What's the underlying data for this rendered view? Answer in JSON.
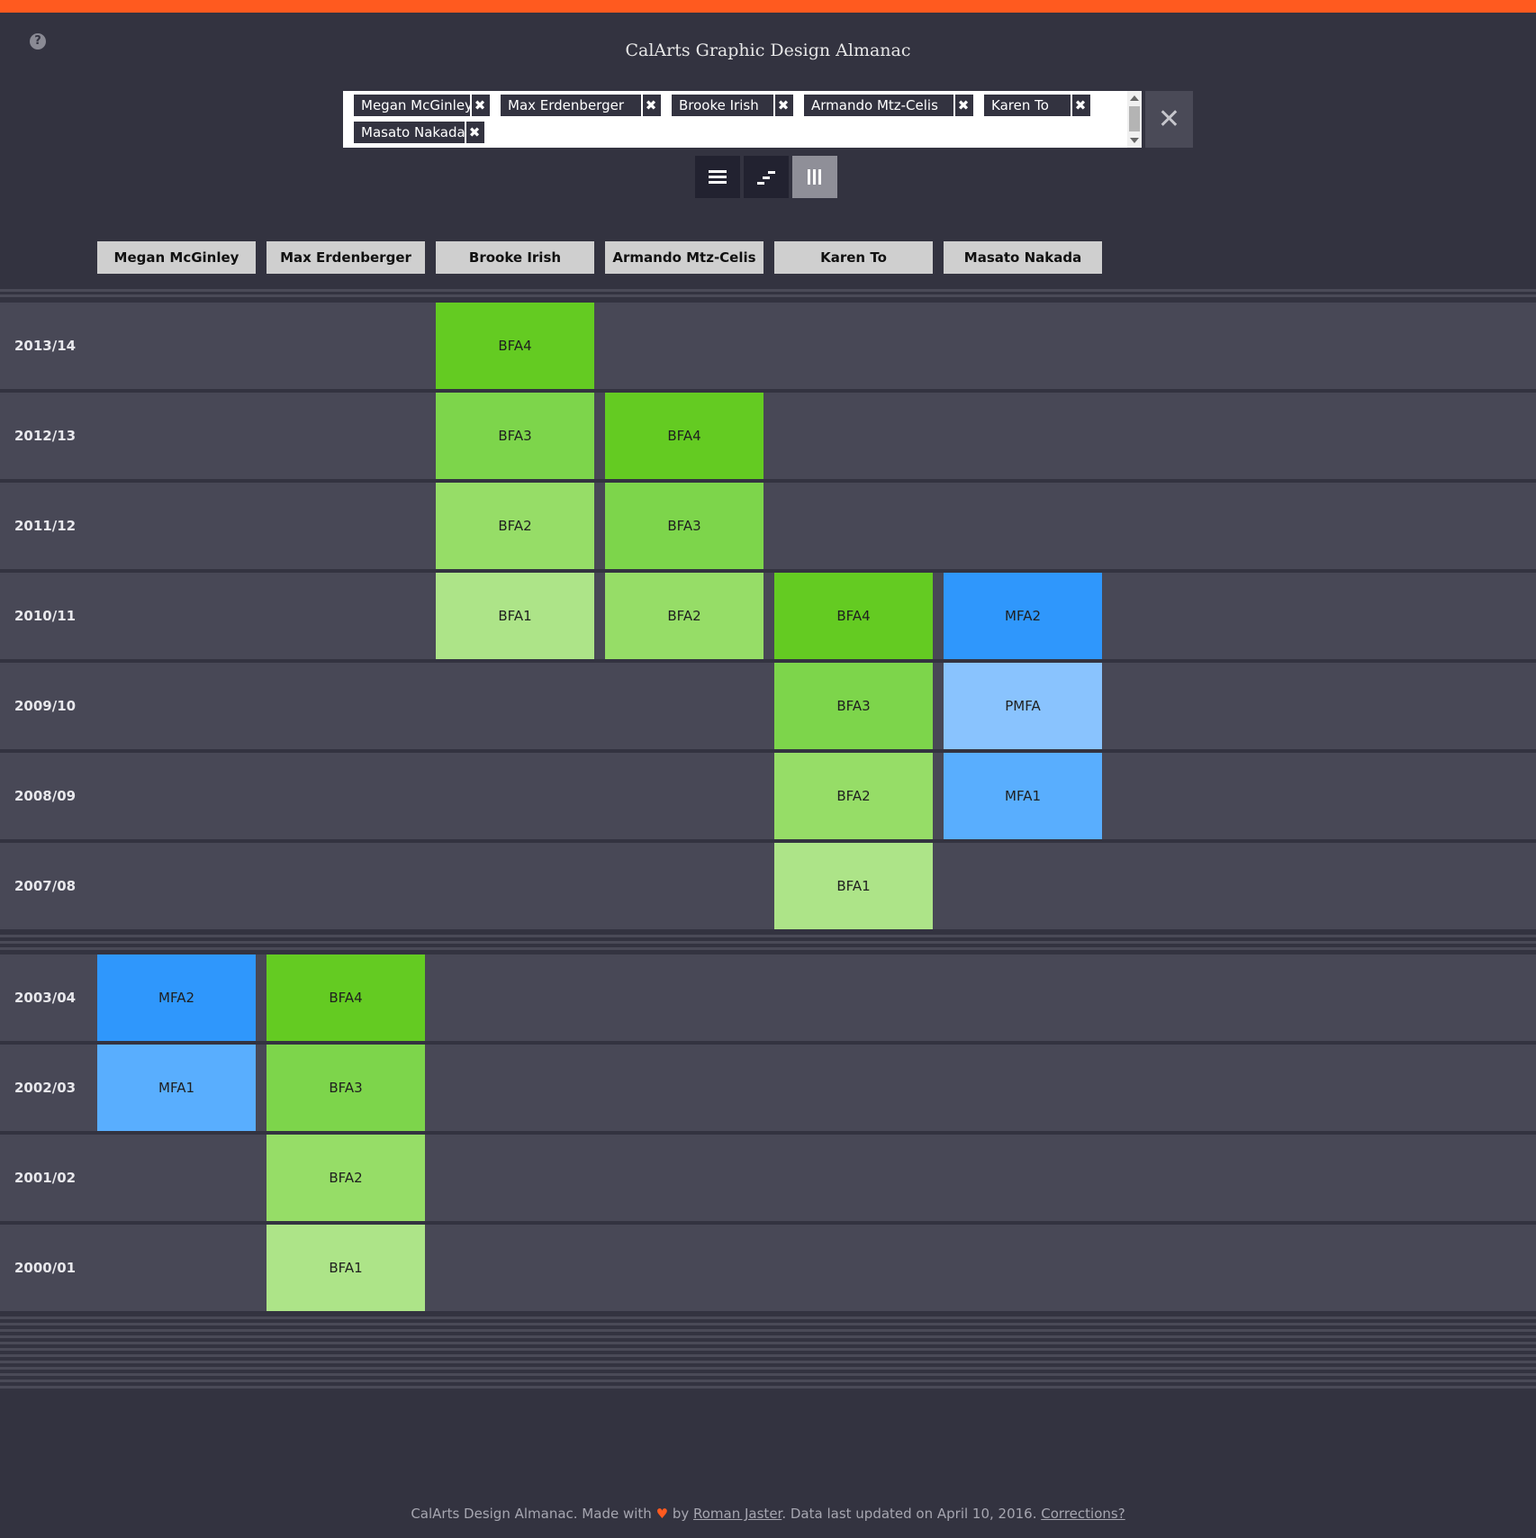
{
  "app": {
    "title": "CalArts Graphic Design Almanac",
    "help_icon": "?"
  },
  "filter": {
    "tags": [
      "Megan McGinley",
      "Max Erdenberger",
      "Brooke Irish",
      "Armando Mtz-Celis",
      "Karen To",
      "Masato Nakada"
    ],
    "remove_glyph": "✖",
    "clear_glyph": "✕"
  },
  "views": [
    "list-icon",
    "timeline-icon",
    "columns-icon"
  ],
  "active_view": "columns-icon",
  "columns": [
    "Megan McGinley",
    "Max Erdenberger",
    "Brooke Irish",
    "Armando Mtz-Celis",
    "Karen To",
    "Masato Nakada"
  ],
  "colors": {
    "BFA1": "#ade488",
    "BFA2": "#96dd67",
    "BFA3": "#7dd54b",
    "BFA4": "#64cb22",
    "MFA1": "#59aefe",
    "MFA2": "#2f97fc",
    "PMFA": "#89c3fe",
    "accent": "#ff5a1f"
  },
  "years": [
    {
      "label": "2013/14",
      "cells": [
        "",
        "",
        "BFA4",
        "",
        "",
        ""
      ]
    },
    {
      "label": "2012/13",
      "cells": [
        "",
        "",
        "BFA3",
        "BFA4",
        "",
        ""
      ]
    },
    {
      "label": "2011/12",
      "cells": [
        "",
        "",
        "BFA2",
        "BFA3",
        "",
        ""
      ]
    },
    {
      "label": "2010/11",
      "cells": [
        "",
        "",
        "BFA1",
        "BFA2",
        "BFA4",
        "MFA2"
      ]
    },
    {
      "label": "2009/10",
      "cells": [
        "",
        "",
        "",
        "",
        "BFA3",
        "PMFA"
      ]
    },
    {
      "label": "2008/09",
      "cells": [
        "",
        "",
        "",
        "",
        "BFA2",
        "MFA1"
      ]
    },
    {
      "label": "2007/08",
      "cells": [
        "",
        "",
        "",
        "",
        "BFA1",
        ""
      ]
    },
    {
      "label": "2003/04",
      "cells": [
        "MFA2",
        "BFA4",
        "",
        "",
        "",
        ""
      ]
    },
    {
      "label": "2002/03",
      "cells": [
        "MFA1",
        "BFA3",
        "",
        "",
        "",
        ""
      ]
    },
    {
      "label": "2001/02",
      "cells": [
        "",
        "BFA2",
        "",
        "",
        "",
        ""
      ]
    },
    {
      "label": "2000/01",
      "cells": [
        "",
        "BFA1",
        "",
        "",
        "",
        ""
      ]
    }
  ],
  "footer": {
    "prefix": "CalArts Design Almanac. Made with",
    "heart": "♥",
    "by": "by",
    "author": "Roman Jaster",
    "updated": ". Data last updated on April 10, 2016.",
    "corrections": "Corrections?"
  }
}
